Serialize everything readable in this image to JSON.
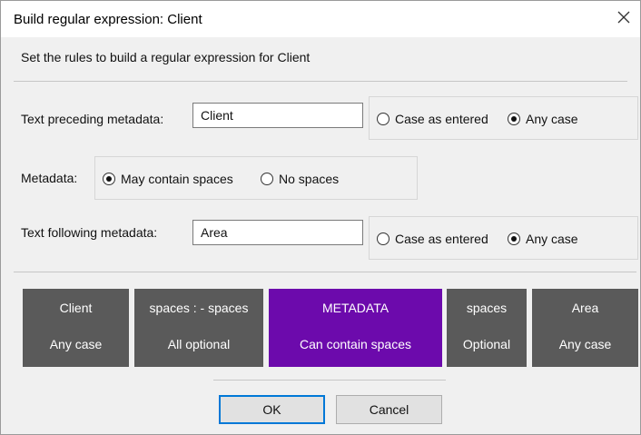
{
  "window": {
    "title": "Build regular expression: Client",
    "close_label": "✕"
  },
  "intro": "Set the rules to build a regular expression for Client",
  "preceding": {
    "label": "Text preceding metadata:",
    "value": "Client",
    "options": [
      "Case as entered",
      "Any case"
    ],
    "selected": "Any case"
  },
  "metadata": {
    "label": "Metadata:",
    "options": [
      "May contain spaces",
      "No spaces"
    ],
    "selected": "May contain spaces"
  },
  "following": {
    "label": "Text following metadata:",
    "value": "Area",
    "options": [
      "Case as entered",
      "Any case"
    ],
    "selected": "Any case"
  },
  "tiles": [
    {
      "line1": "Client",
      "line2": "Any case"
    },
    {
      "line1": "spaces : - spaces",
      "line2": "All optional"
    },
    {
      "line1": "METADATA",
      "line2": "Can contain spaces"
    },
    {
      "line1": "spaces",
      "line2": "Optional"
    },
    {
      "line1": "Area",
      "line2": "Any case"
    }
  ],
  "colors": {
    "tile": "#5a5a5a",
    "tile_metadata": "#6c0aac",
    "default_button_border": "#0078d7"
  },
  "buttons": {
    "ok": "OK",
    "cancel": "Cancel"
  }
}
